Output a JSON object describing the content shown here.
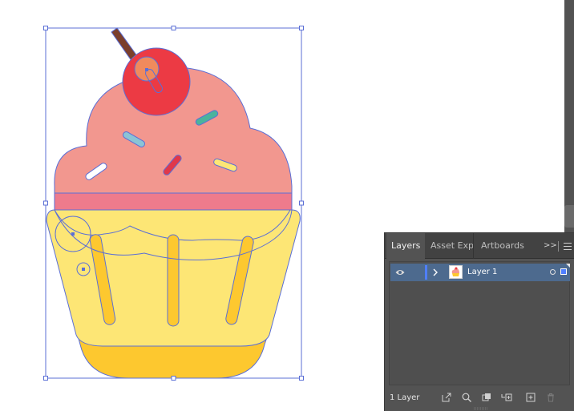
{
  "panel": {
    "tabs": [
      {
        "label": "Layers",
        "active": true
      },
      {
        "label": "Asset Expor",
        "active": false
      },
      {
        "label": "Artboards",
        "active": false
      }
    ],
    "overflow_label": ">>",
    "layers": [
      {
        "name": "Layer 1",
        "visible": true,
        "expanded": false,
        "selected": true,
        "color": "#4f7fff"
      }
    ],
    "footer": {
      "count_label": "1 Layer",
      "icons": [
        "export-icon",
        "search-icon",
        "clipping-mask-icon",
        "new-sublayer-icon",
        "new-layer-icon",
        "delete-icon"
      ]
    }
  },
  "colors": {
    "frosting": "#f2978f",
    "frosting_band": "#ee7b8c",
    "cup": "#fde675",
    "cup_bottom": "#fdc82f",
    "cup_stripes": "#fdc82f",
    "cherry": "#ec3a44",
    "stem": "#7b3f2c",
    "selection": "#5b6fd6",
    "panel_bg": "#535353",
    "row_highlight": "#4d6a8e"
  }
}
